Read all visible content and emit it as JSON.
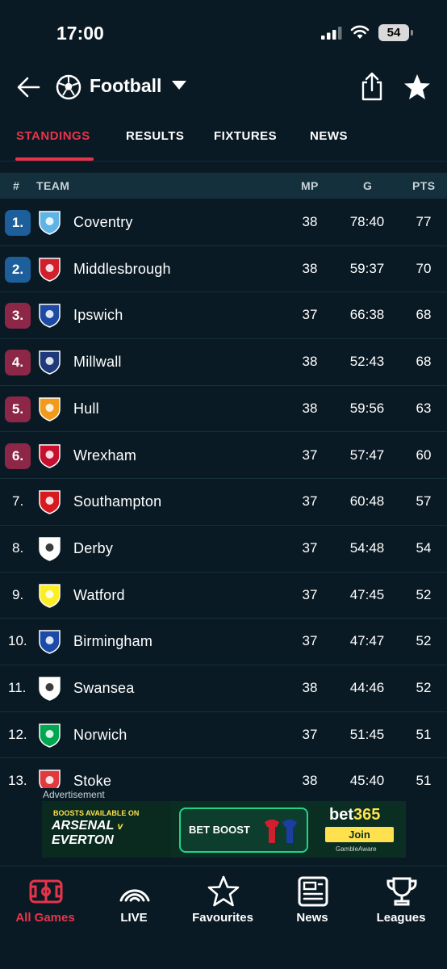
{
  "status": {
    "time": "17:00",
    "battery": "54"
  },
  "header": {
    "title": "Football"
  },
  "tabs": [
    {
      "label": "STANDINGS",
      "active": true
    },
    {
      "label": "RESULTS"
    },
    {
      "label": "FIXTURES"
    },
    {
      "label": "NEWS"
    }
  ],
  "table": {
    "headers": {
      "pos": "#",
      "team": "TEAM",
      "mp": "MP",
      "g": "G",
      "pts": "PTS"
    },
    "rows": [
      {
        "pos": "1.",
        "team": "Coventry",
        "mp": "38",
        "g": "78:40",
        "pts": "77",
        "zone": "cl",
        "crest_color": "#5fb4e6"
      },
      {
        "pos": "2.",
        "team": "Middlesbrough",
        "mp": "38",
        "g": "59:37",
        "pts": "70",
        "zone": "cl",
        "crest_color": "#d0202e"
      },
      {
        "pos": "3.",
        "team": "Ipswich",
        "mp": "37",
        "g": "66:38",
        "pts": "68",
        "zone": "po",
        "crest_color": "#1d4aa3"
      },
      {
        "pos": "4.",
        "team": "Millwall",
        "mp": "38",
        "g": "52:43",
        "pts": "68",
        "zone": "po",
        "crest_color": "#1e3a7a"
      },
      {
        "pos": "5.",
        "team": "Hull",
        "mp": "38",
        "g": "59:56",
        "pts": "63",
        "zone": "po",
        "crest_color": "#f29a1c"
      },
      {
        "pos": "6.",
        "team": "Wrexham",
        "mp": "37",
        "g": "57:47",
        "pts": "60",
        "zone": "po",
        "crest_color": "#c8102e"
      },
      {
        "pos": "7.",
        "team": "Southampton",
        "mp": "37",
        "g": "60:48",
        "pts": "57",
        "zone": "",
        "crest_color": "#d71920"
      },
      {
        "pos": "8.",
        "team": "Derby",
        "mp": "37",
        "g": "54:48",
        "pts": "54",
        "zone": "",
        "crest_color": "#ffffff"
      },
      {
        "pos": "9.",
        "team": "Watford",
        "mp": "37",
        "g": "47:45",
        "pts": "52",
        "zone": "",
        "crest_color": "#fbee23"
      },
      {
        "pos": "10.",
        "team": "Birmingham",
        "mp": "37",
        "g": "47:47",
        "pts": "52",
        "zone": "",
        "crest_color": "#1b4aa8"
      },
      {
        "pos": "11.",
        "team": "Swansea",
        "mp": "38",
        "g": "44:46",
        "pts": "52",
        "zone": "",
        "crest_color": "#ffffff"
      },
      {
        "pos": "12.",
        "team": "Norwich",
        "mp": "37",
        "g": "51:45",
        "pts": "51",
        "zone": "",
        "crest_color": "#00a650"
      },
      {
        "pos": "13.",
        "team": "Stoke",
        "mp": "38",
        "g": "45:40",
        "pts": "51",
        "zone": "",
        "crest_color": "#e03a3e"
      }
    ]
  },
  "ad": {
    "label": "Advertisement",
    "boost_text": "BOOSTS AVAILABLE ON",
    "team1": "ARSENAL",
    "vs": "v",
    "team2": "EVERTON",
    "bet_boost": "BET BOOST",
    "brand_a": "bet",
    "brand_b": "365",
    "join": "Join",
    "gamble": "GambleAware"
  },
  "nav": [
    {
      "label": "All Games",
      "icon": "pitch-icon",
      "active": true
    },
    {
      "label": "LIVE",
      "icon": "live-icon"
    },
    {
      "label": "Favourites",
      "icon": "star-outline-icon"
    },
    {
      "label": "News",
      "icon": "news-icon"
    },
    {
      "label": "Leagues",
      "icon": "trophy-icon"
    }
  ],
  "colors": {
    "accent": "#e8344a",
    "cl_zone": "#1c5f9a",
    "po_zone": "#8c2747",
    "background": "#0a1a24"
  }
}
